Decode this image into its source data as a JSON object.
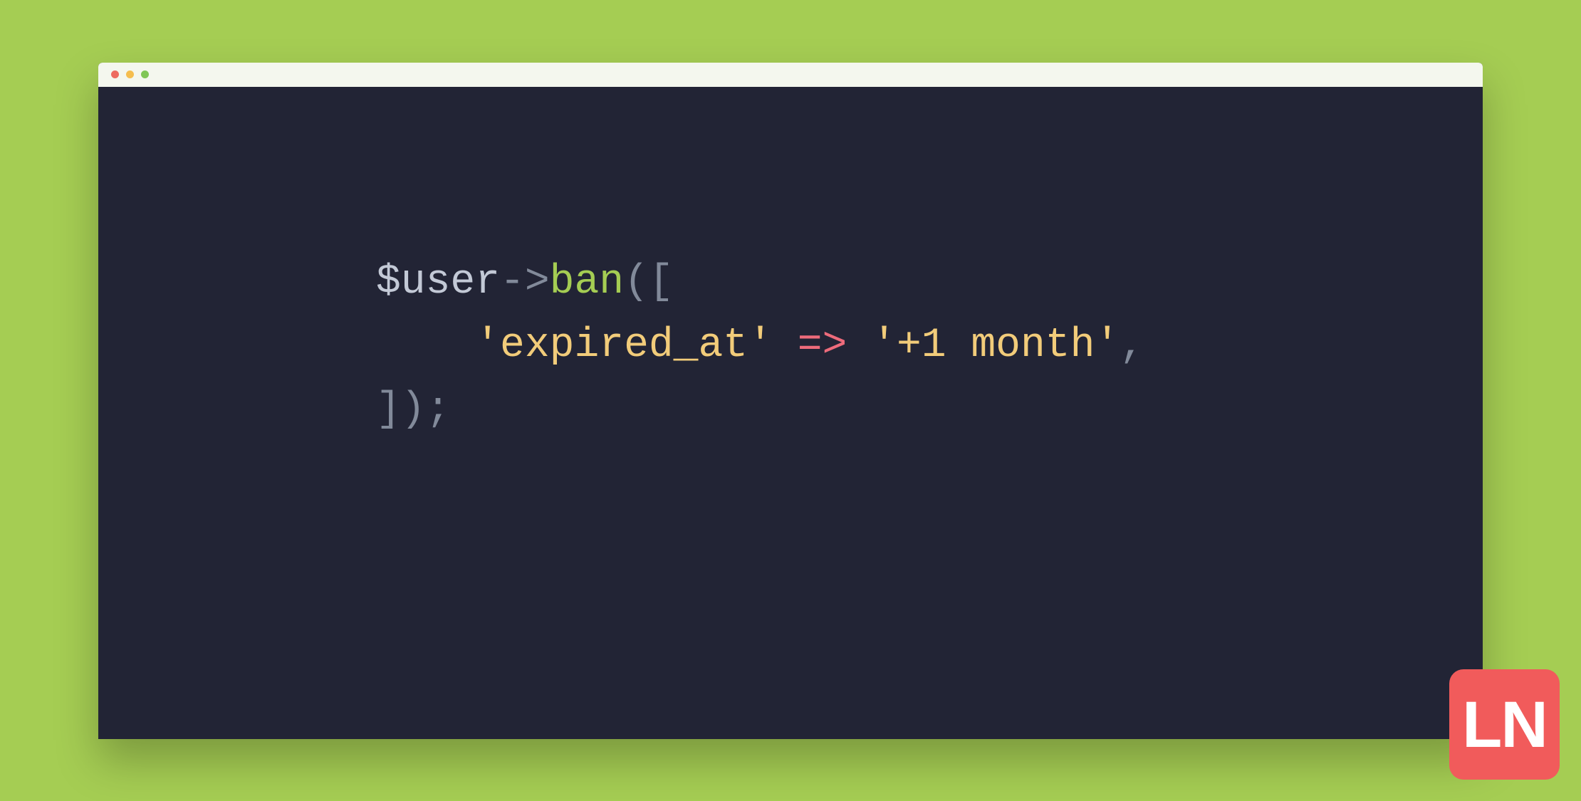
{
  "code": {
    "line1": {
      "var": "$user",
      "arrow1": "->",
      "func": "ban",
      "open": "(["
    },
    "line2": {
      "indent": "    ",
      "key": "'expired_at'",
      "arrow2": " => ",
      "value": "'+1 month'",
      "comma": ","
    },
    "line3": {
      "close": "]);"
    }
  },
  "logo": {
    "text": "LN"
  }
}
